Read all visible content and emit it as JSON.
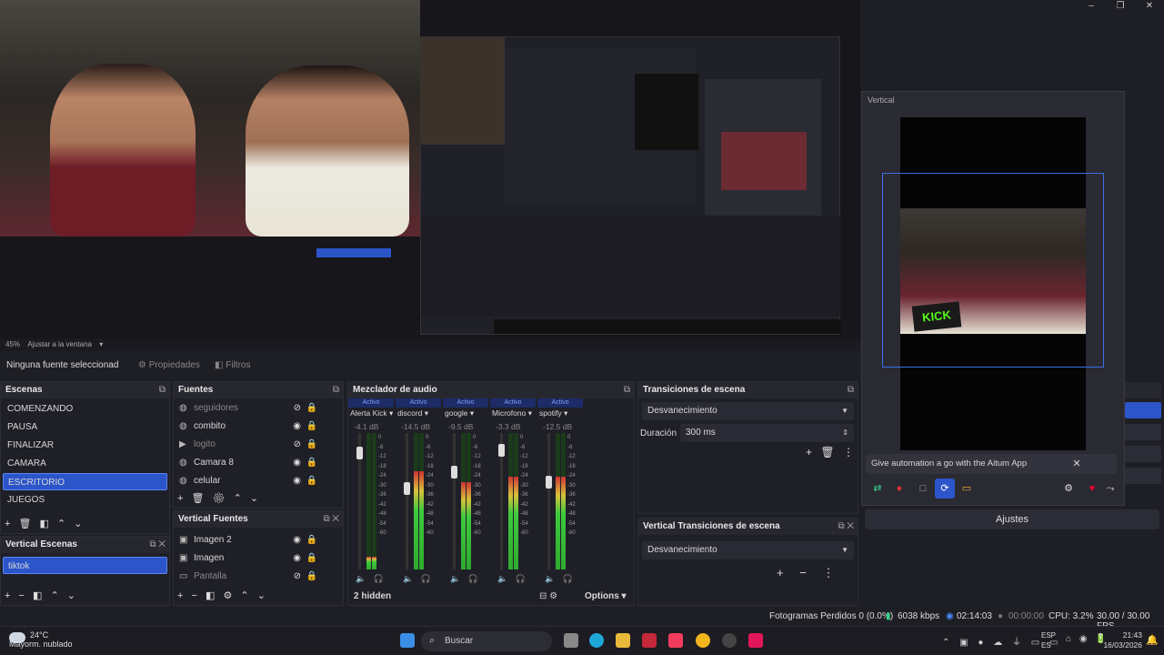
{
  "window": {
    "minimize": "–",
    "restore": "❐",
    "close": "✕"
  },
  "zoom": {
    "level": "45%",
    "fit": "Ajustar a la ventana"
  },
  "source_bar": {
    "selected_source": "Ninguna fuente seleccionad",
    "properties": "Propiedades",
    "filters": "Filtros"
  },
  "vertical_panel": {
    "title": "Vertical",
    "kick_logo": "KICK",
    "aitum_message": "Give automation a go with the Aitum App",
    "close": "✕",
    "settings_button": "Ajustes"
  },
  "scenes": {
    "title": "Escenas",
    "items": [
      "COMENZANDO",
      "PAUSA",
      "FINALIZAR",
      "CAMARA",
      "ESCRITORIO",
      "JUEGOS"
    ],
    "selected": "ESCRITORIO"
  },
  "vertical_scenes": {
    "title": "Vertical Escenas",
    "items": [
      "tiktok"
    ]
  },
  "sources": {
    "title": "Fuentes",
    "items": [
      {
        "name": "seguidores",
        "visible": false
      },
      {
        "name": "combito",
        "visible": true
      },
      {
        "name": "logito",
        "visible": false
      },
      {
        "name": "Camara 8",
        "visible": true
      },
      {
        "name": "celular",
        "visible": true
      }
    ]
  },
  "vertical_sources": {
    "title": "Vertical Fuentes",
    "items": [
      {
        "name": "Imagen 2",
        "visible": true
      },
      {
        "name": "Imagen",
        "visible": true
      },
      {
        "name": "Pantalla",
        "visible": false
      }
    ]
  },
  "mixer": {
    "title": "Mezclador de audio",
    "active_label": "Activo",
    "hidden": "2 hidden",
    "options": "Options",
    "scale": [
      "0",
      "-6",
      "-12",
      "-18",
      "-24",
      "-30",
      "-36",
      "-42",
      "-48",
      "-54",
      "-60"
    ],
    "channels": [
      {
        "name": "Alerta Kick",
        "db": "-4.1 dB",
        "level": 0.12
      },
      {
        "name": "discord",
        "db": "-14.5 dB",
        "level": 0.9
      },
      {
        "name": "google",
        "db": "-9.5 dB",
        "level": 0.8
      },
      {
        "name": "Microfono",
        "db": "-3.3 dB",
        "level": 0.85
      },
      {
        "name": "spotify",
        "db": "-12.5 dB",
        "level": 0.85
      }
    ]
  },
  "transitions": {
    "title": "Transiciones de escena",
    "type": "Desvanecimiento",
    "duration_label": "Duración",
    "duration": "300 ms"
  },
  "vertical_transitions": {
    "title": "Vertical Transiciones de escena",
    "type": "Desvanecimiento"
  },
  "status": {
    "dropped": "Fotogramas Perdidos 0 (0.0%)",
    "bitrate": "6038 kbps",
    "stream_time": "02:14:03",
    "rec_time": "00:00:00",
    "cpu": "CPU: 3.2%",
    "fps": "30.00 / 30.00 FPS"
  },
  "taskbar": {
    "temp": "24°C",
    "weather": "Mayorm. nublado",
    "search": "Buscar",
    "lang1": "ESP",
    "lang2": "ES",
    "time": "21:43",
    "date": "16/03/2026"
  }
}
